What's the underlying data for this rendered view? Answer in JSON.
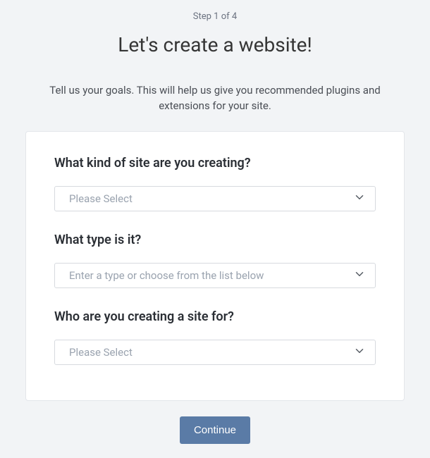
{
  "step": "Step 1 of 4",
  "title": "Let's create a website!",
  "subtitle": "Tell us your goals. This will help us give you recommended plugins and extensions for your site.",
  "fields": {
    "kind": {
      "label": "What kind of site are you creating?",
      "placeholder": "Please Select"
    },
    "type": {
      "label": "What type is it?",
      "placeholder": "Enter a type or choose from the list below"
    },
    "who": {
      "label": "Who are you creating a site for?",
      "placeholder": "Please Select"
    }
  },
  "footer": {
    "continue_label": "Continue"
  }
}
